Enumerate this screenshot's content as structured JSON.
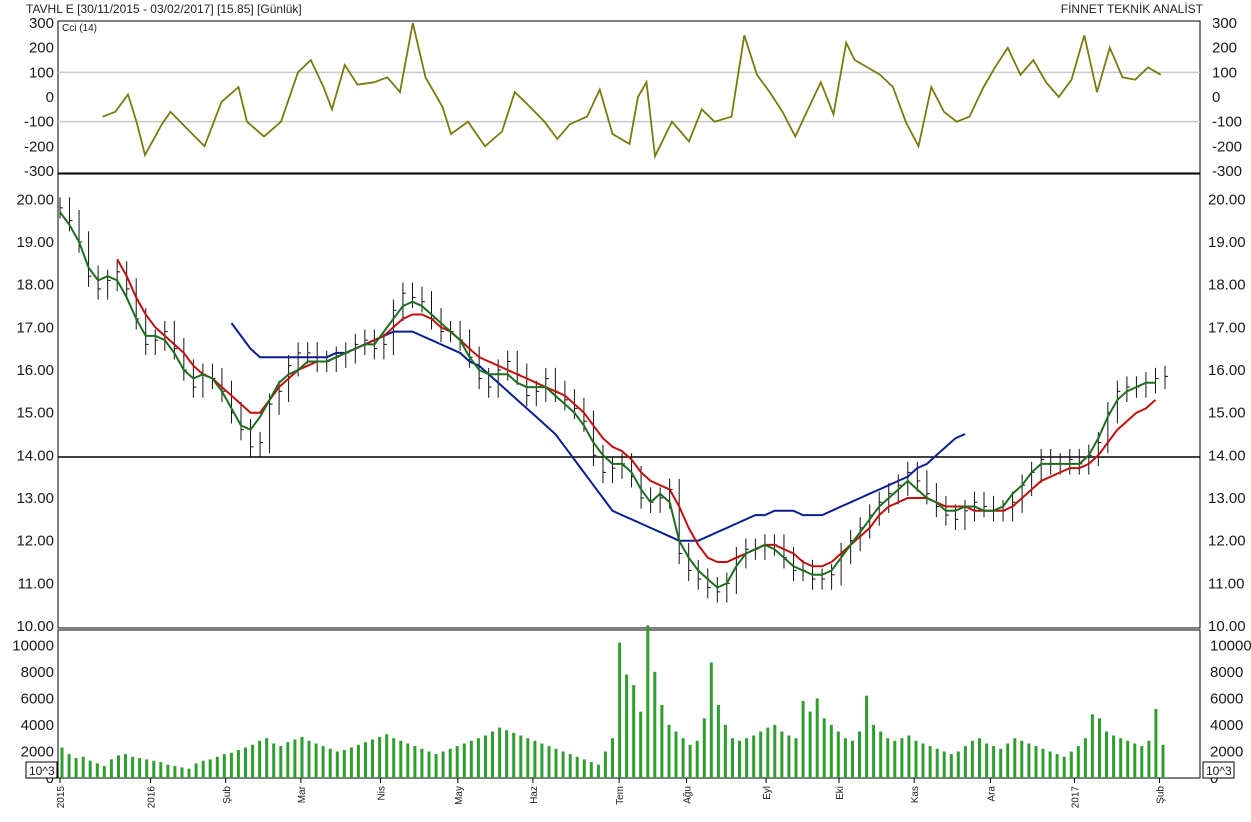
{
  "header": {
    "title": "TAVHL E  [30/11/2015 - 03/02/2017]  [15.85]  [Günlük]",
    "brand": "FİNNET TEKNİK ANALİST"
  },
  "colors": {
    "cci": "#7a7a10",
    "price_bars": "#111111",
    "ma_short": "#1f6e1f",
    "ma_mid": "#c01010",
    "ma_long": "#0b1f8f",
    "volume": "#2f9e2f",
    "reference_line": "#000000",
    "panel_border": "#000000",
    "grid": "#c8c8c8"
  },
  "chart_data": [
    {
      "type": "line",
      "panel": "cci",
      "title": "Cci (14)",
      "ylim": [
        -300,
        300
      ],
      "y_ticks": [
        "300",
        "200",
        "100",
        "0",
        "-100",
        "-200",
        "-300"
      ],
      "reference_levels": [
        100,
        -100
      ],
      "series": [
        {
          "name": "Cci (14)",
          "values": [
            [
              0.09,
              -80
            ],
            [
              0.105,
              -60
            ],
            [
              0.12,
              10
            ],
            [
              0.13,
              -100
            ],
            [
              0.14,
              -235
            ],
            [
              0.16,
              -110
            ],
            [
              0.17,
              -60
            ],
            [
              0.19,
              -130
            ],
            [
              0.21,
              -200
            ],
            [
              0.23,
              -20
            ],
            [
              0.25,
              40
            ],
            [
              0.26,
              -100
            ],
            [
              0.28,
              -160
            ],
            [
              0.3,
              -100
            ],
            [
              0.32,
              100
            ],
            [
              0.335,
              150
            ],
            [
              0.35,
              40
            ],
            [
              0.36,
              -50
            ],
            [
              0.375,
              130
            ],
            [
              0.39,
              50
            ],
            [
              0.41,
              60
            ],
            [
              0.425,
              80
            ],
            [
              0.44,
              20
            ],
            [
              0.455,
              300
            ],
            [
              0.47,
              80
            ],
            [
              0.49,
              -40
            ],
            [
              0.5,
              -150
            ],
            [
              0.52,
              -100
            ],
            [
              0.54,
              -200
            ],
            [
              0.56,
              -140
            ],
            [
              0.575,
              20
            ],
            [
              0.59,
              -30
            ],
            [
              0.61,
              -100
            ],
            [
              0.625,
              -170
            ],
            [
              0.64,
              -110
            ],
            [
              0.66,
              -80
            ],
            [
              0.675,
              30
            ],
            [
              0.69,
              -150
            ],
            [
              0.71,
              -190
            ],
            [
              0.72,
              0
            ],
            [
              0.73,
              60
            ],
            [
              0.74,
              -240
            ],
            [
              0.76,
              -100
            ],
            [
              0.78,
              -180
            ],
            [
              0.795,
              -50
            ],
            [
              0.81,
              -100
            ],
            [
              0.83,
              -80
            ],
            [
              0.845,
              250
            ],
            [
              0.86,
              90
            ],
            [
              0.875,
              20
            ],
            [
              0.89,
              -60
            ],
            [
              0.905,
              -160
            ],
            [
              0.92,
              -50
            ],
            [
              0.935,
              60
            ],
            [
              0.95,
              -70
            ],
            [
              0.965,
              220
            ],
            [
              0.975,
              150
            ],
            [
              0.99,
              120
            ],
            [
              1.005,
              90
            ],
            [
              1.02,
              40
            ],
            [
              1.035,
              -100
            ],
            [
              1.05,
              -200
            ],
            [
              1.065,
              40
            ],
            [
              1.08,
              -60
            ],
            [
              1.095,
              -100
            ],
            [
              1.11,
              -80
            ],
            [
              1.125,
              30
            ],
            [
              1.14,
              120
            ],
            [
              1.155,
              200
            ],
            [
              1.17,
              90
            ],
            [
              1.185,
              150
            ],
            [
              1.2,
              60
            ],
            [
              1.215,
              0
            ],
            [
              1.23,
              70
            ],
            [
              1.245,
              250
            ],
            [
              1.26,
              20
            ],
            [
              1.275,
              200
            ],
            [
              1.29,
              80
            ],
            [
              1.305,
              70
            ],
            [
              1.32,
              120
            ],
            [
              1.335,
              90
            ]
          ]
        }
      ]
    },
    {
      "type": "line",
      "panel": "price",
      "ylim": [
        10.0,
        20.5
      ],
      "y_ticks": [
        "20.00",
        "19.00",
        "18.00",
        "17.00",
        "16.00",
        "15.00",
        "14.00",
        "13.00",
        "12.00",
        "11.00",
        "10.00"
      ],
      "reference_levels": [
        13.96
      ],
      "x_tick_labels": [
        "2015",
        "2016",
        "Şub",
        "Mar",
        "Nis",
        "May",
        "Haz",
        "Tem",
        "Ağu",
        "Eyl",
        "Eki",
        "Kas",
        "Ara",
        "2017",
        "Şub"
      ],
      "series": [
        {
          "name": "price",
          "values": [
            19.8,
            19.5,
            19.0,
            18.2,
            17.9,
            18.1,
            18.3,
            17.9,
            17.2,
            16.6,
            16.7,
            16.9,
            16.5,
            16.0,
            15.6,
            15.9,
            15.8,
            15.5,
            15.0,
            14.6,
            14.2,
            14.3,
            15.2,
            15.5,
            16.1,
            16.4,
            16.4,
            16.2,
            16.2,
            16.3,
            16.4,
            16.6,
            16.7,
            16.5,
            16.6,
            17.4,
            17.8,
            17.7,
            17.6,
            17.2,
            16.9,
            16.9,
            16.7,
            16.3,
            15.8,
            15.6,
            16.0,
            16.2,
            15.9,
            15.4,
            15.5,
            15.8,
            15.5,
            15.3,
            15.1,
            14.8,
            14.0,
            13.6,
            13.7,
            13.8,
            13.5,
            13.0,
            12.9,
            13.0,
            13.2,
            11.7,
            11.3,
            11.1,
            10.9,
            10.8,
            11.0,
            11.6,
            11.8,
            11.8,
            11.9,
            11.9,
            11.6,
            11.3,
            11.3,
            11.1,
            11.1,
            11.2,
            11.7,
            12.0,
            12.3,
            12.6,
            12.9,
            13.1,
            13.3,
            13.6,
            13.4,
            13.1,
            12.8,
            12.6,
            12.5,
            12.7,
            12.9,
            12.8,
            12.7,
            12.7,
            12.9,
            13.3,
            13.6,
            13.9,
            13.8,
            13.8,
            13.9,
            13.8,
            14.0,
            14.3,
            15.0,
            15.5,
            15.6,
            15.6,
            15.7,
            15.8,
            15.85
          ]
        },
        {
          "name": "ma_short",
          "values": [
            19.7,
            19.4,
            19.0,
            18.4,
            18.1,
            18.2,
            18.1,
            17.7,
            17.2,
            16.8,
            16.8,
            16.7,
            16.4,
            16.0,
            15.8,
            15.9,
            15.8,
            15.5,
            15.1,
            14.7,
            14.6,
            14.9,
            15.3,
            15.7,
            15.9,
            16.0,
            16.2,
            16.2,
            16.2,
            16.3,
            16.4,
            16.5,
            16.6,
            16.6,
            16.9,
            17.2,
            17.5,
            17.6,
            17.5,
            17.3,
            17.1,
            16.9,
            16.7,
            16.3,
            16.0,
            15.9,
            15.9,
            15.9,
            15.7,
            15.6,
            15.6,
            15.6,
            15.4,
            15.2,
            15.0,
            14.7,
            14.3,
            14.0,
            13.8,
            13.8,
            13.6,
            13.2,
            12.9,
            13.1,
            12.9,
            12.0,
            11.6,
            11.3,
            11.1,
            10.9,
            11.0,
            11.4,
            11.7,
            11.8,
            11.9,
            11.8,
            11.6,
            11.4,
            11.3,
            11.2,
            11.2,
            11.3,
            11.6,
            11.9,
            12.2,
            12.5,
            12.8,
            13.0,
            13.2,
            13.4,
            13.2,
            13.0,
            12.9,
            12.7,
            12.7,
            12.8,
            12.8,
            12.7,
            12.7,
            12.8,
            13.1,
            13.3,
            13.6,
            13.8,
            13.8,
            13.8,
            13.8,
            13.8,
            14.0,
            14.4,
            14.9,
            15.3,
            15.5,
            15.6,
            15.7,
            15.7
          ]
        },
        {
          "name": "ma_mid",
          "values": [
            null,
            null,
            null,
            null,
            null,
            null,
            18.6,
            18.2,
            17.7,
            17.3,
            17.0,
            16.8,
            16.6,
            16.4,
            16.1,
            15.9,
            15.8,
            15.6,
            15.4,
            15.2,
            15.0,
            15.0,
            15.3,
            15.6,
            15.8,
            16.0,
            16.1,
            16.2,
            16.2,
            16.3,
            16.4,
            16.5,
            16.6,
            16.7,
            16.8,
            17.0,
            17.2,
            17.3,
            17.3,
            17.2,
            17.0,
            16.9,
            16.7,
            16.5,
            16.3,
            16.2,
            16.1,
            16.0,
            15.9,
            15.8,
            15.7,
            15.6,
            15.5,
            15.4,
            15.2,
            15.0,
            14.7,
            14.4,
            14.2,
            14.1,
            13.9,
            13.6,
            13.4,
            13.3,
            13.2,
            12.8,
            12.3,
            11.9,
            11.6,
            11.5,
            11.5,
            11.6,
            11.7,
            11.8,
            11.9,
            11.9,
            11.8,
            11.7,
            11.5,
            11.4,
            11.4,
            11.5,
            11.7,
            11.9,
            12.1,
            12.3,
            12.6,
            12.8,
            12.9,
            13.0,
            13.0,
            13.0,
            12.9,
            12.8,
            12.8,
            12.8,
            12.7,
            12.7,
            12.7,
            12.7,
            12.8,
            13.0,
            13.2,
            13.4,
            13.5,
            13.6,
            13.7,
            13.7,
            13.8,
            14.0,
            14.3,
            14.6,
            14.8,
            15.0,
            15.1,
            15.3
          ]
        },
        {
          "name": "ma_long",
          "values": [
            null,
            null,
            null,
            null,
            null,
            null,
            null,
            null,
            null,
            null,
            null,
            null,
            null,
            null,
            null,
            null,
            null,
            null,
            17.1,
            16.8,
            16.5,
            16.3,
            16.3,
            16.3,
            16.3,
            16.3,
            16.3,
            16.3,
            16.3,
            16.4,
            16.4,
            16.5,
            16.6,
            16.7,
            16.8,
            16.9,
            16.9,
            16.9,
            16.8,
            16.7,
            16.6,
            16.5,
            16.4,
            16.2,
            16.1,
            15.9,
            15.7,
            15.5,
            15.3,
            15.1,
            14.9,
            14.7,
            14.5,
            14.2,
            13.9,
            13.6,
            13.3,
            13.0,
            12.7,
            12.6,
            12.5,
            12.4,
            12.3,
            12.2,
            12.1,
            12.0,
            12.0,
            12.0,
            12.1,
            12.2,
            12.3,
            12.4,
            12.5,
            12.6,
            12.6,
            12.7,
            12.7,
            12.7,
            12.6,
            12.6,
            12.6,
            12.7,
            12.8,
            12.9,
            13.0,
            13.1,
            13.2,
            13.3,
            13.4,
            13.5,
            13.7,
            13.8,
            14.0,
            14.2,
            14.4,
            14.5
          ]
        }
      ]
    },
    {
      "type": "bar",
      "panel": "volume",
      "ylim": [
        0,
        11000
      ],
      "y_ticks": [
        "10000",
        "8000",
        "6000",
        "4000",
        "2000",
        "0"
      ],
      "unit": "10^3",
      "series": [
        {
          "name": "volume",
          "values": [
            2300,
            1800,
            1500,
            1600,
            1300,
            1100,
            900,
            1400,
            1700,
            1800,
            1600,
            1500,
            1400,
            1300,
            1200,
            1000,
            900,
            800,
            700,
            1100,
            1300,
            1400,
            1600,
            1800,
            1900,
            2100,
            2300,
            2500,
            2800,
            3000,
            2600,
            2400,
            2700,
            2900,
            3100,
            2800,
            2600,
            2400,
            2200,
            2000,
            2100,
            2300,
            2500,
            2700,
            2900,
            3100,
            3300,
            3000,
            2800,
            2600,
            2400,
            2200,
            2000,
            1800,
            2000,
            2200,
            2400,
            2600,
            2800,
            3000,
            3200,
            3500,
            3800,
            3600,
            3400,
            3200,
            3000,
            2800,
            2600,
            2400,
            2200,
            2000,
            1800,
            1600,
            1400,
            1200,
            1000,
            2000,
            3000,
            10200,
            7800,
            7000,
            5000,
            11500,
            8000,
            5500,
            4000,
            3500,
            3000,
            2500,
            2800,
            4500,
            8700,
            5500,
            4000,
            3000,
            2800,
            3000,
            3200,
            3500,
            3800,
            4000,
            3500,
            3200,
            3000,
            5800,
            5000,
            6000,
            4500,
            4000,
            3500,
            3000,
            2800,
            3500,
            6200,
            4000,
            3500,
            3000,
            2800,
            3000,
            3200,
            2800,
            2600,
            2400,
            2200,
            2000,
            1800,
            2000,
            2400,
            2800,
            3000,
            2600,
            2400,
            2200,
            2600,
            3000,
            2800,
            2600,
            2400,
            2200,
            2000,
            1800,
            1600,
            2000,
            2400,
            3000,
            4800,
            4500,
            3500,
            3200,
            3000,
            2800,
            2600,
            2400,
            2800,
            5200,
            2500
          ]
        }
      ]
    }
  ]
}
